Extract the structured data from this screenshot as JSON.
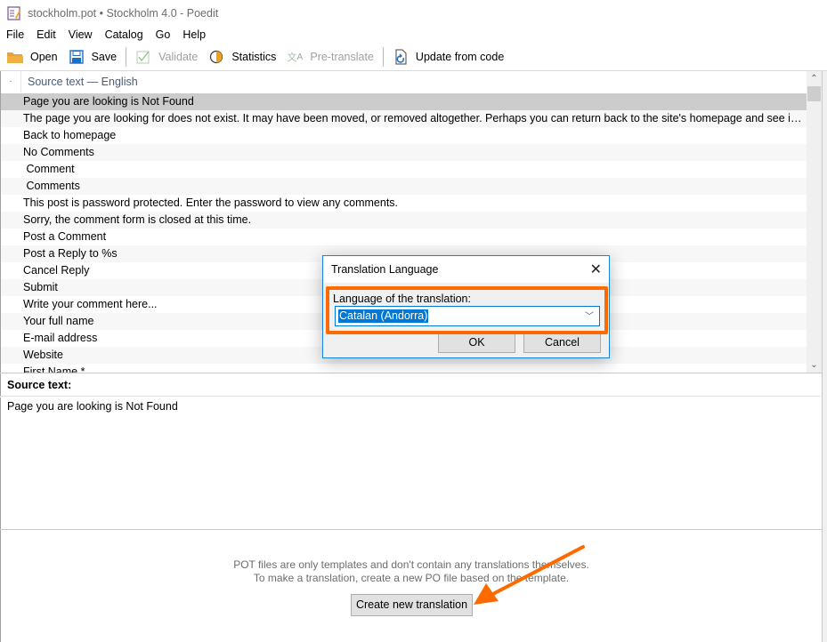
{
  "window": {
    "title": "stockholm.pot • Stockholm 4.0 - Poedit",
    "app_icon": "poedit-icon"
  },
  "menu": [
    "File",
    "Edit",
    "View",
    "Catalog",
    "Go",
    "Help"
  ],
  "toolbar": {
    "open": {
      "label": "Open",
      "icon": "folder-icon",
      "enabled": true
    },
    "save": {
      "label": "Save",
      "icon": "floppy-icon",
      "enabled": true
    },
    "validate": {
      "label": "Validate",
      "icon": "checkbox-icon",
      "enabled": false
    },
    "statistics": {
      "label": "Statistics",
      "icon": "pie-chart-icon",
      "enabled": true
    },
    "pretranslate": {
      "label": "Pre-translate",
      "icon": "translate-icon",
      "enabled": false
    },
    "update": {
      "label": "Update from code",
      "icon": "update-icon",
      "enabled": true
    }
  },
  "list": {
    "header_marker": "·",
    "column_header": "Source text — English",
    "selected_index": 0,
    "rows": [
      "Page you are looking is Not Found",
      "The page you are looking for does not exist. It may have been moved, or removed altogether. Perhaps you can return back to the site's homepage and see if you can ...",
      "Back to homepage",
      "No Comments",
      " Comment",
      " Comments",
      "This post is password protected. Enter the password to view any comments.",
      "Sorry, the comment form is closed at this time.",
      "Post a Comment",
      "Post a Reply to %s",
      "Cancel Reply",
      "Submit",
      "Write your comment here...",
      "Your full name",
      "E-mail address",
      "Website",
      "First Name *"
    ]
  },
  "source_panel": {
    "label": "Source text:",
    "text": "Page you are looking is Not Found"
  },
  "bottom_panel": {
    "line1": "POT files are only templates and don't contain any translations themselves.",
    "line2": "To make a translation, create a new PO file based on the template.",
    "create_button": "Create new translation"
  },
  "dialog": {
    "title": "Translation Language",
    "close": "✕",
    "field_label": "Language of the translation:",
    "selected_language": "Catalan (Andorra)",
    "ok": "OK",
    "cancel": "Cancel"
  },
  "annotations": {
    "highlight_color": "#ff6a00",
    "arrow_color": "#ff6a00"
  }
}
